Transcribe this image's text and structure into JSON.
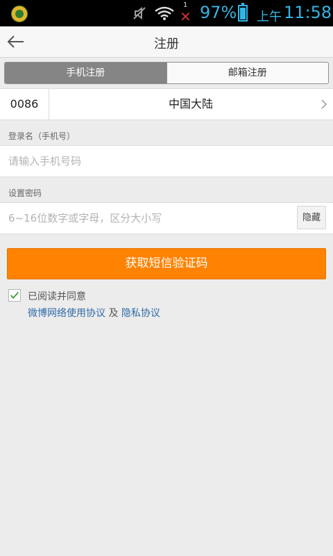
{
  "status_bar": {
    "battery_percent": "97%",
    "ampm": "上午",
    "time": "11:58",
    "signal_indicator": "1",
    "accent_color": "#33b5e5"
  },
  "header": {
    "title": "注册",
    "back_icon": "arrow-left-icon"
  },
  "tabs": [
    {
      "label": "手机注册",
      "active": true
    },
    {
      "label": "邮箱注册",
      "active": false
    }
  ],
  "country": {
    "code": "0086",
    "name": "中国大陆"
  },
  "phone": {
    "label": "登录名（手机号）",
    "placeholder": "请输入手机号码",
    "value": ""
  },
  "password": {
    "label": "设置密码",
    "placeholder": "6~16位数字或字母，区分大小写",
    "value": "",
    "toggle_label": "隐藏"
  },
  "submit": {
    "label": "获取短信验证码",
    "color": "#ff8200"
  },
  "agreement": {
    "checked": true,
    "text": "已阅读并同意",
    "link1": "微博网络使用协议",
    "and": "及",
    "link2": "隐私协议",
    "link_color": "#2f6aa7"
  }
}
